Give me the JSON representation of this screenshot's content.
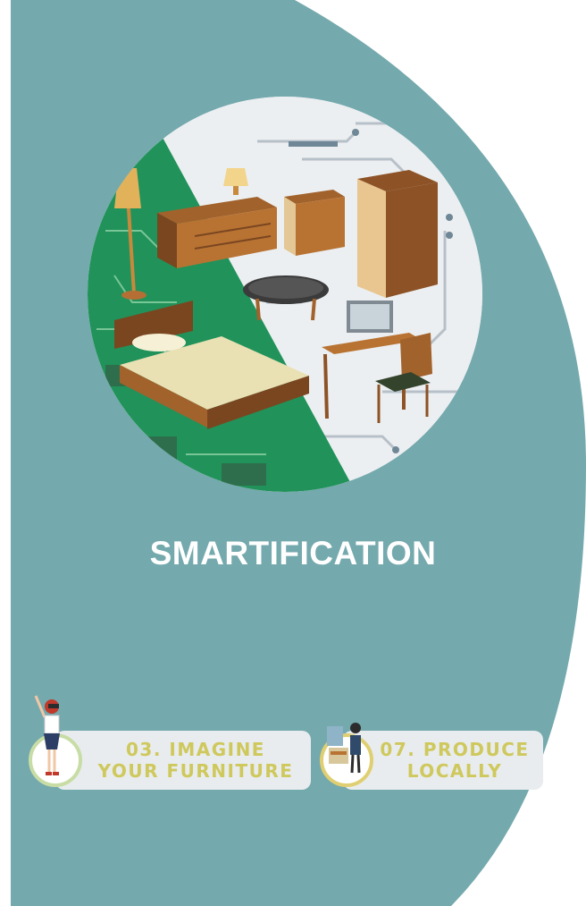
{
  "panel": {
    "color": "#74a9ad"
  },
  "hero": {
    "image": "smart furniture over circuit board illustration"
  },
  "title": "SMARTIFICATION",
  "tags": [
    {
      "label": "03. IMAGINE\nYOUR FURNITURE",
      "accent": "#c8dda5",
      "figure": "vr-user-figure"
    },
    {
      "label": "07. PRODUCE\nLOCALLY",
      "accent": "#e0cf72",
      "figure": "workshop-worker-figure"
    }
  ],
  "colors": {
    "tag_text": "#cfc85c",
    "tag_bg": "#e8ecee"
  }
}
